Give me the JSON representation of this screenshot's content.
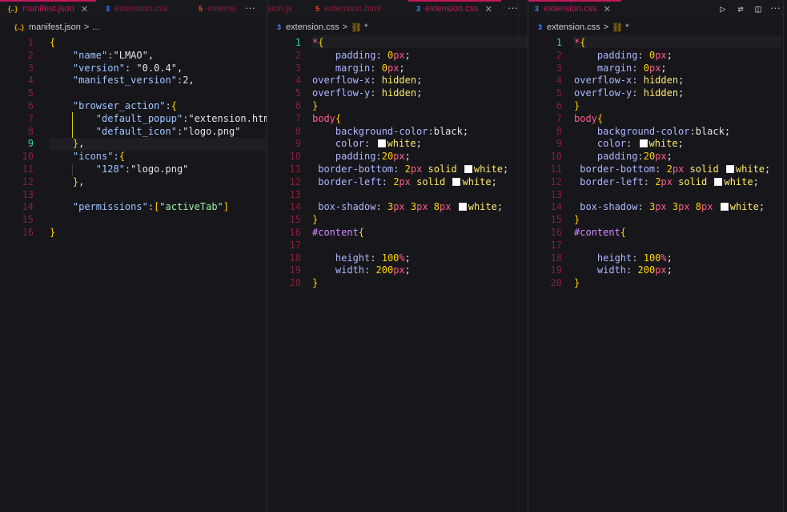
{
  "panes": [
    {
      "id": "left",
      "tabs": [
        {
          "icon": "{..}",
          "label": "manifest.json",
          "active": true,
          "close": "✕"
        },
        {
          "icon": "3",
          "label": "extension.css",
          "active": false
        },
        {
          "icon": "5",
          "label": "extensi",
          "active": false
        }
      ],
      "breadcrumb": [
        "manifest.json",
        ">",
        "..."
      ],
      "lines": [
        "1",
        "2",
        "3",
        "4",
        "5",
        "6",
        "7",
        "8",
        "9",
        "10",
        "11",
        "12",
        "13",
        "14",
        "15",
        "16"
      ],
      "current_line": "9",
      "code": [
        "{",
        "    \"name\":\"LMAO\",",
        "    \"version\": \"0.0.4\",",
        "    \"manifest_version\":2,",
        "",
        "    \"browser_action\":{",
        "        \"default_popup\":\"extension.html\"",
        "        \"default_icon\":\"logo.png\"",
        "    },",
        "    \"icons\":{",
        "        \"128\":\"logo.png\"",
        "    },",
        "",
        "    \"permissions\":[\"activeTab\"]",
        "",
        "}"
      ]
    },
    {
      "id": "middle",
      "tabs": [
        {
          "icon": "",
          "label": "sion.js",
          "active": false
        },
        {
          "icon": "5",
          "label": "extension.html",
          "active": false
        },
        {
          "icon": "3",
          "label": "extension.css",
          "active": true,
          "close": "✕"
        }
      ],
      "breadcrumb": [
        "extension.css",
        ">",
        "*"
      ],
      "lines": [
        "1",
        "2",
        "3",
        "4",
        "5",
        "6",
        "7",
        "8",
        "9",
        "10",
        "11",
        "12",
        "13",
        "14",
        "15",
        "16",
        "17",
        "18",
        "19",
        "20"
      ],
      "current_line": "1",
      "code": [
        "*{",
        "    padding: 0px;",
        "    margin: 0px;",
        "overflow-x: hidden;",
        "overflow-y: hidden;",
        "}",
        "body{",
        "    background-color:black;",
        "    color: white;",
        "    padding:20px;",
        " border-bottom: 2px solid white;",
        " border-left: 2px solid white;",
        "",
        " box-shadow: 3px 3px 8px white;",
        "}",
        "#content{",
        "",
        "    height: 100%;",
        "    width: 200px;",
        "}"
      ]
    },
    {
      "id": "right",
      "tabs": [
        {
          "icon": "3",
          "label": "extension.css",
          "active": true,
          "close": "✕"
        }
      ],
      "breadcrumb": [
        "extension.css",
        ">",
        "*"
      ],
      "lines": [
        "1",
        "2",
        "3",
        "4",
        "5",
        "6",
        "7",
        "8",
        "9",
        "10",
        "11",
        "12",
        "13",
        "14",
        "15",
        "16",
        "17",
        "18",
        "19",
        "20"
      ],
      "current_line": "1",
      "code": [
        "*{",
        "    padding: 0px;",
        "    margin: 0px;",
        "overflow-x: hidden;",
        "overflow-y: hidden;",
        "}",
        "body{",
        "    background-color:black;",
        "    color: white;",
        "    padding:20px;",
        " border-bottom: 2px solid white;",
        " border-left: 2px solid white;",
        "",
        " box-shadow: 3px 3px 8px white;",
        "}",
        "#content{",
        "",
        "    height: 100%;",
        "    width: 200px;",
        "}"
      ]
    }
  ],
  "toolbar": {
    "more_label": "···",
    "icons": [
      "run-icon",
      "compare-icon",
      "split-icon",
      "more-icon"
    ]
  },
  "colors": {
    "accent": "#c2185b",
    "background": "#16161b",
    "line_number": "#8a1e3a",
    "current_line_number": "#38d39f"
  }
}
